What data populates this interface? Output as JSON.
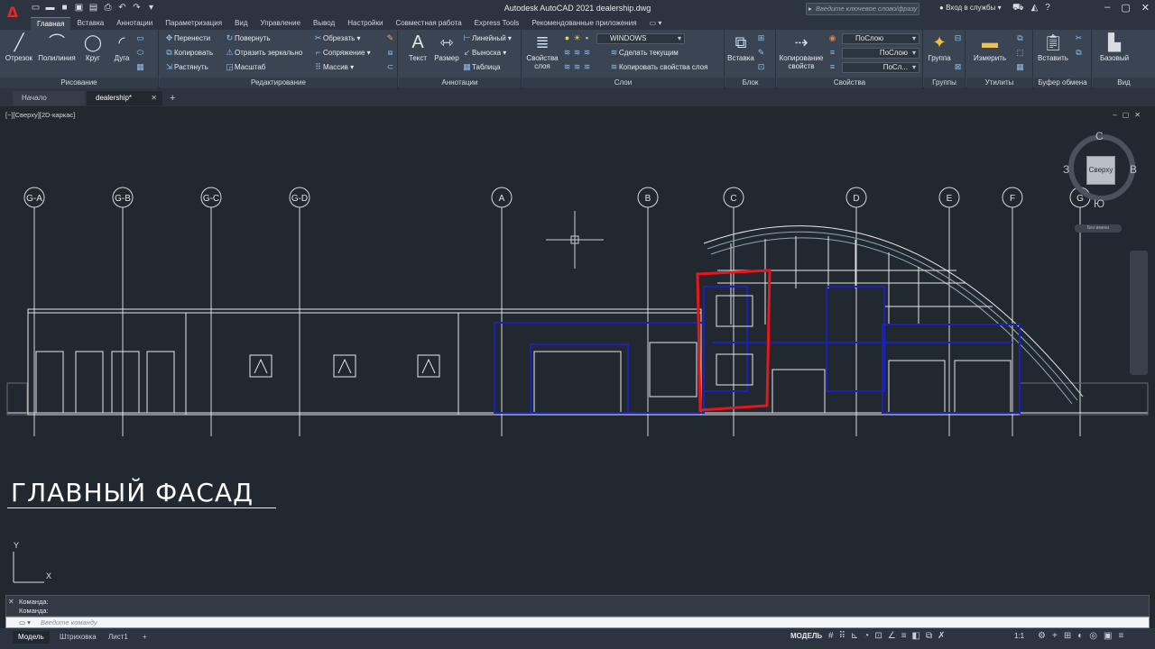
{
  "app": {
    "logo": "A",
    "title": "Autodesk AutoCAD 2021   dealership.dwg",
    "search_placeholder": "Введите ключевое слово/фразу",
    "signin": "Вход в службы",
    "qat_icons": [
      "new-icon",
      "open-icon",
      "save-icon",
      "saveas-icon",
      "web-icon",
      "print-icon",
      "undo-icon",
      "redo-icon",
      "more-icon"
    ]
  },
  "ribbon_tabs": [
    "Главная",
    "Вставка",
    "Аннотации",
    "Параметризация",
    "Вид",
    "Управление",
    "Вывод",
    "Настройки",
    "Совместная работа",
    "Express Tools",
    "Рекомендованные приложения"
  ],
  "ribbon_active_tab": "Главная",
  "panels": {
    "draw": {
      "title": "Рисование",
      "line": "Отрезок",
      "polyline": "Полилиния",
      "circle": "Круг",
      "arc": "Дуга"
    },
    "modify": {
      "title": "Редактирование",
      "move": "Перенести",
      "rotate": "Повернуть",
      "trim": "Обрезать",
      "copy": "Копировать",
      "mirror": "Отразить зеркально",
      "fillet": "Сопряжение",
      "stretch": "Растянуть",
      "scale": "Масштаб",
      "array": "Массив"
    },
    "annotation": {
      "title": "Аннотации",
      "text": "Текст",
      "dimension": "Размер",
      "linear": "Линейный",
      "leader": "Выноска",
      "table": "Таблица"
    },
    "layers": {
      "title": "Слои",
      "properties": "Свойства слоя",
      "current_layer": "WINDOWS",
      "make_current": "Сделать текущим",
      "match_layer": "Копировать свойства слоя"
    },
    "block": {
      "title": "Блок",
      "insert": "Вставка"
    },
    "properties": {
      "title": "Свойства",
      "match": "Копирование свойств",
      "color": "ПоСлою",
      "linetype": "ПоСлою",
      "lineweight": "ПоСл..."
    },
    "groups": {
      "title": "Группы",
      "group": "Группа"
    },
    "utilities": {
      "title": "Утилиты",
      "measure": "Измерить"
    },
    "clipboard": {
      "title": "Буфер обмена",
      "paste": "Вставить"
    },
    "view": {
      "title": "Вид",
      "base": "Базовый"
    }
  },
  "doc_tabs": [
    "Начало",
    "dealership*"
  ],
  "view_label": "[−][Сверху][2D-каркас]",
  "viewcube": {
    "face": "Сверху",
    "north": "С",
    "south": "Ю",
    "east": "В",
    "west": "З",
    "wcs": "Без имени"
  },
  "grid_bubbles": [
    "G-A",
    "G-B",
    "G-C",
    "G-D",
    "A",
    "B",
    "C",
    "D",
    "E",
    "F",
    "G"
  ],
  "sheet_title_words": [
    "ГЛАВНЫЙ",
    "ФАСАД"
  ],
  "ucs": {
    "y": "Y",
    "x": "X"
  },
  "command": {
    "history": [
      "Команда:",
      "Команда:"
    ],
    "placeholder": "Введите команду"
  },
  "layout_tabs": [
    "Модель",
    "Штриховка",
    "Лист1"
  ],
  "status": {
    "model": "МОДЕЛЬ",
    "scale": "1:1"
  },
  "colors": {
    "highlight": "#e8161b",
    "selection": "#1a1fb0",
    "lines": "#e8e8e8",
    "background": "#212830"
  }
}
